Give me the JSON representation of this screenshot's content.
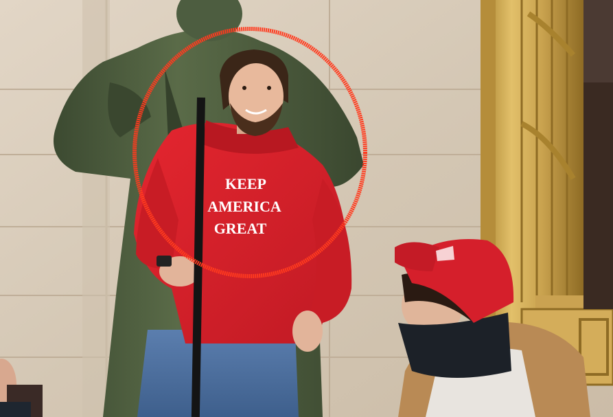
{
  "photo": {
    "hoodie_text": {
      "line1": "KEEP",
      "line2": "AMERICA",
      "line3": "GREAT"
    }
  },
  "colors": {
    "wall_marble": "#d9cdbd",
    "wall_marble_dark": "#c9bba8",
    "statue_bronze": "#4a5a3c",
    "hoodie_red": "#d9202a",
    "highlight_circle": "#ff3b1f",
    "jeans_blue": "#4a6d9c",
    "gold_frame": "#c9a24e",
    "cap_red": "#d51f2b",
    "fur_trim": "#b98a55"
  }
}
